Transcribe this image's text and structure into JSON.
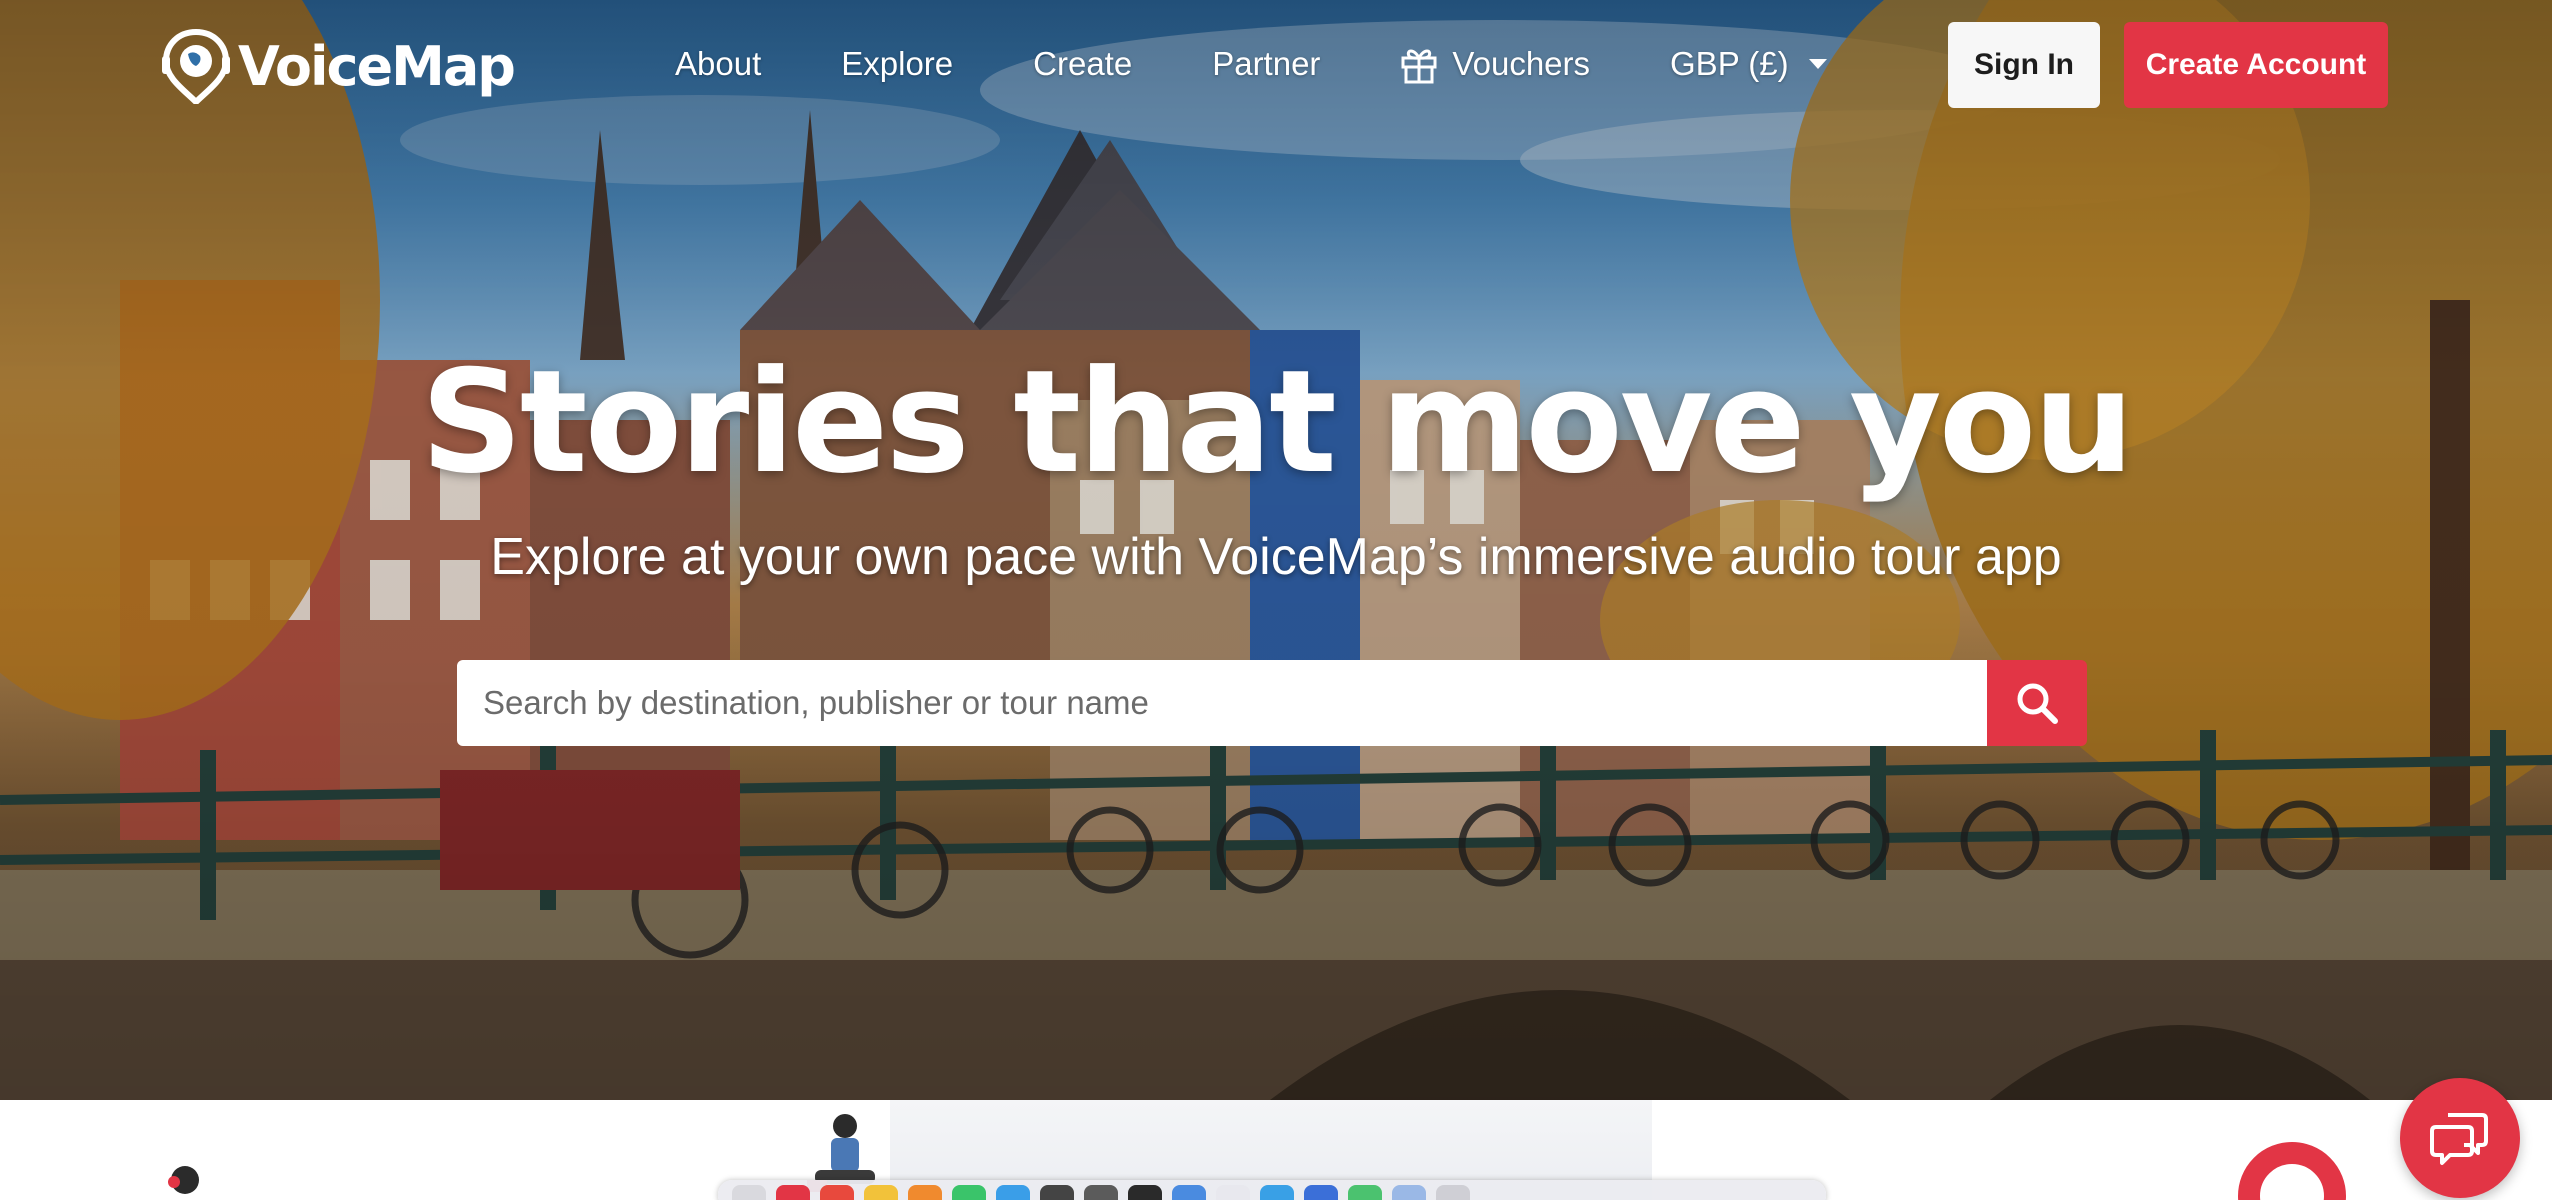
{
  "brand": {
    "name": "VoiceMap",
    "accent": "#e23545"
  },
  "nav": {
    "links": [
      {
        "label": "About"
      },
      {
        "label": "Explore"
      },
      {
        "label": "Create"
      },
      {
        "label": "Partner"
      },
      {
        "label": "Vouchers",
        "icon": "gift-icon"
      }
    ],
    "currency": {
      "label": "GBP (£)",
      "icon": "caret-down-icon"
    },
    "sign_in": "Sign In",
    "create_account": "Create Account"
  },
  "hero": {
    "headline": "Stories that move you",
    "subheadline": "Explore at your own pace with VoiceMap’s immersive audio tour app"
  },
  "search": {
    "placeholder": "Search by destination, publisher or tour name",
    "value": "",
    "button_icon": "search-icon"
  },
  "chat": {
    "icon": "chat-icon"
  }
}
